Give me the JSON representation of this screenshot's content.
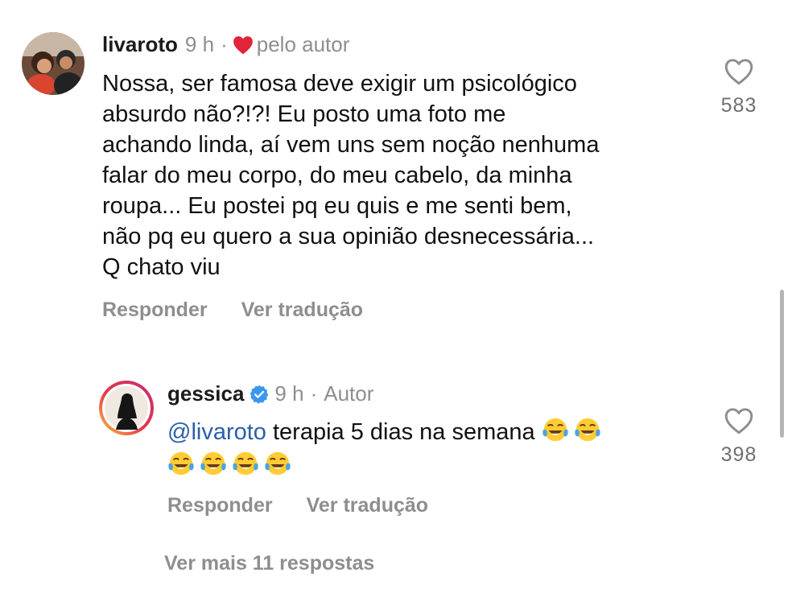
{
  "comments": [
    {
      "username": "livaroto",
      "time": "9 h",
      "separator": "·",
      "badge_text": "pelo autor",
      "text_lines": [
        "Nossa, ser famosa deve exigir um psicológico",
        "absurdo não?!?! Eu posto uma foto me",
        "achando linda, aí vem uns sem noção nenhuma",
        "falar do meu corpo, do meu cabelo, da minha",
        "roupa... Eu postei pq eu quis e me senti bem,",
        "não pq eu quero a sua opinião desnecessária...",
        "Q chato viu"
      ],
      "reply_label": "Responder",
      "translate_label": "Ver tradução",
      "likes": "583",
      "icons": {
        "liked_by_author": "red-heart-icon",
        "like": "heart-outline-icon"
      }
    },
    {
      "username": "gessica",
      "time": "9 h",
      "separator": "·",
      "role": "Autor",
      "mention": "@livaroto",
      "text_line1": " terapia 5 dias na semana ",
      "reply_label": "Responder",
      "translate_label": "Ver tradução",
      "likes": "398",
      "icons": {
        "verified": "verified-badge-icon",
        "like": "heart-outline-icon",
        "emoji": "tears-of-joy-emoji"
      }
    }
  ],
  "more_replies": "Ver mais 11 respostas",
  "colors": {
    "heart_red": "#e0243a",
    "verified_blue": "#3897f0",
    "mention_blue": "#2a5fa8",
    "meta_gray": "#8e8e8e"
  }
}
